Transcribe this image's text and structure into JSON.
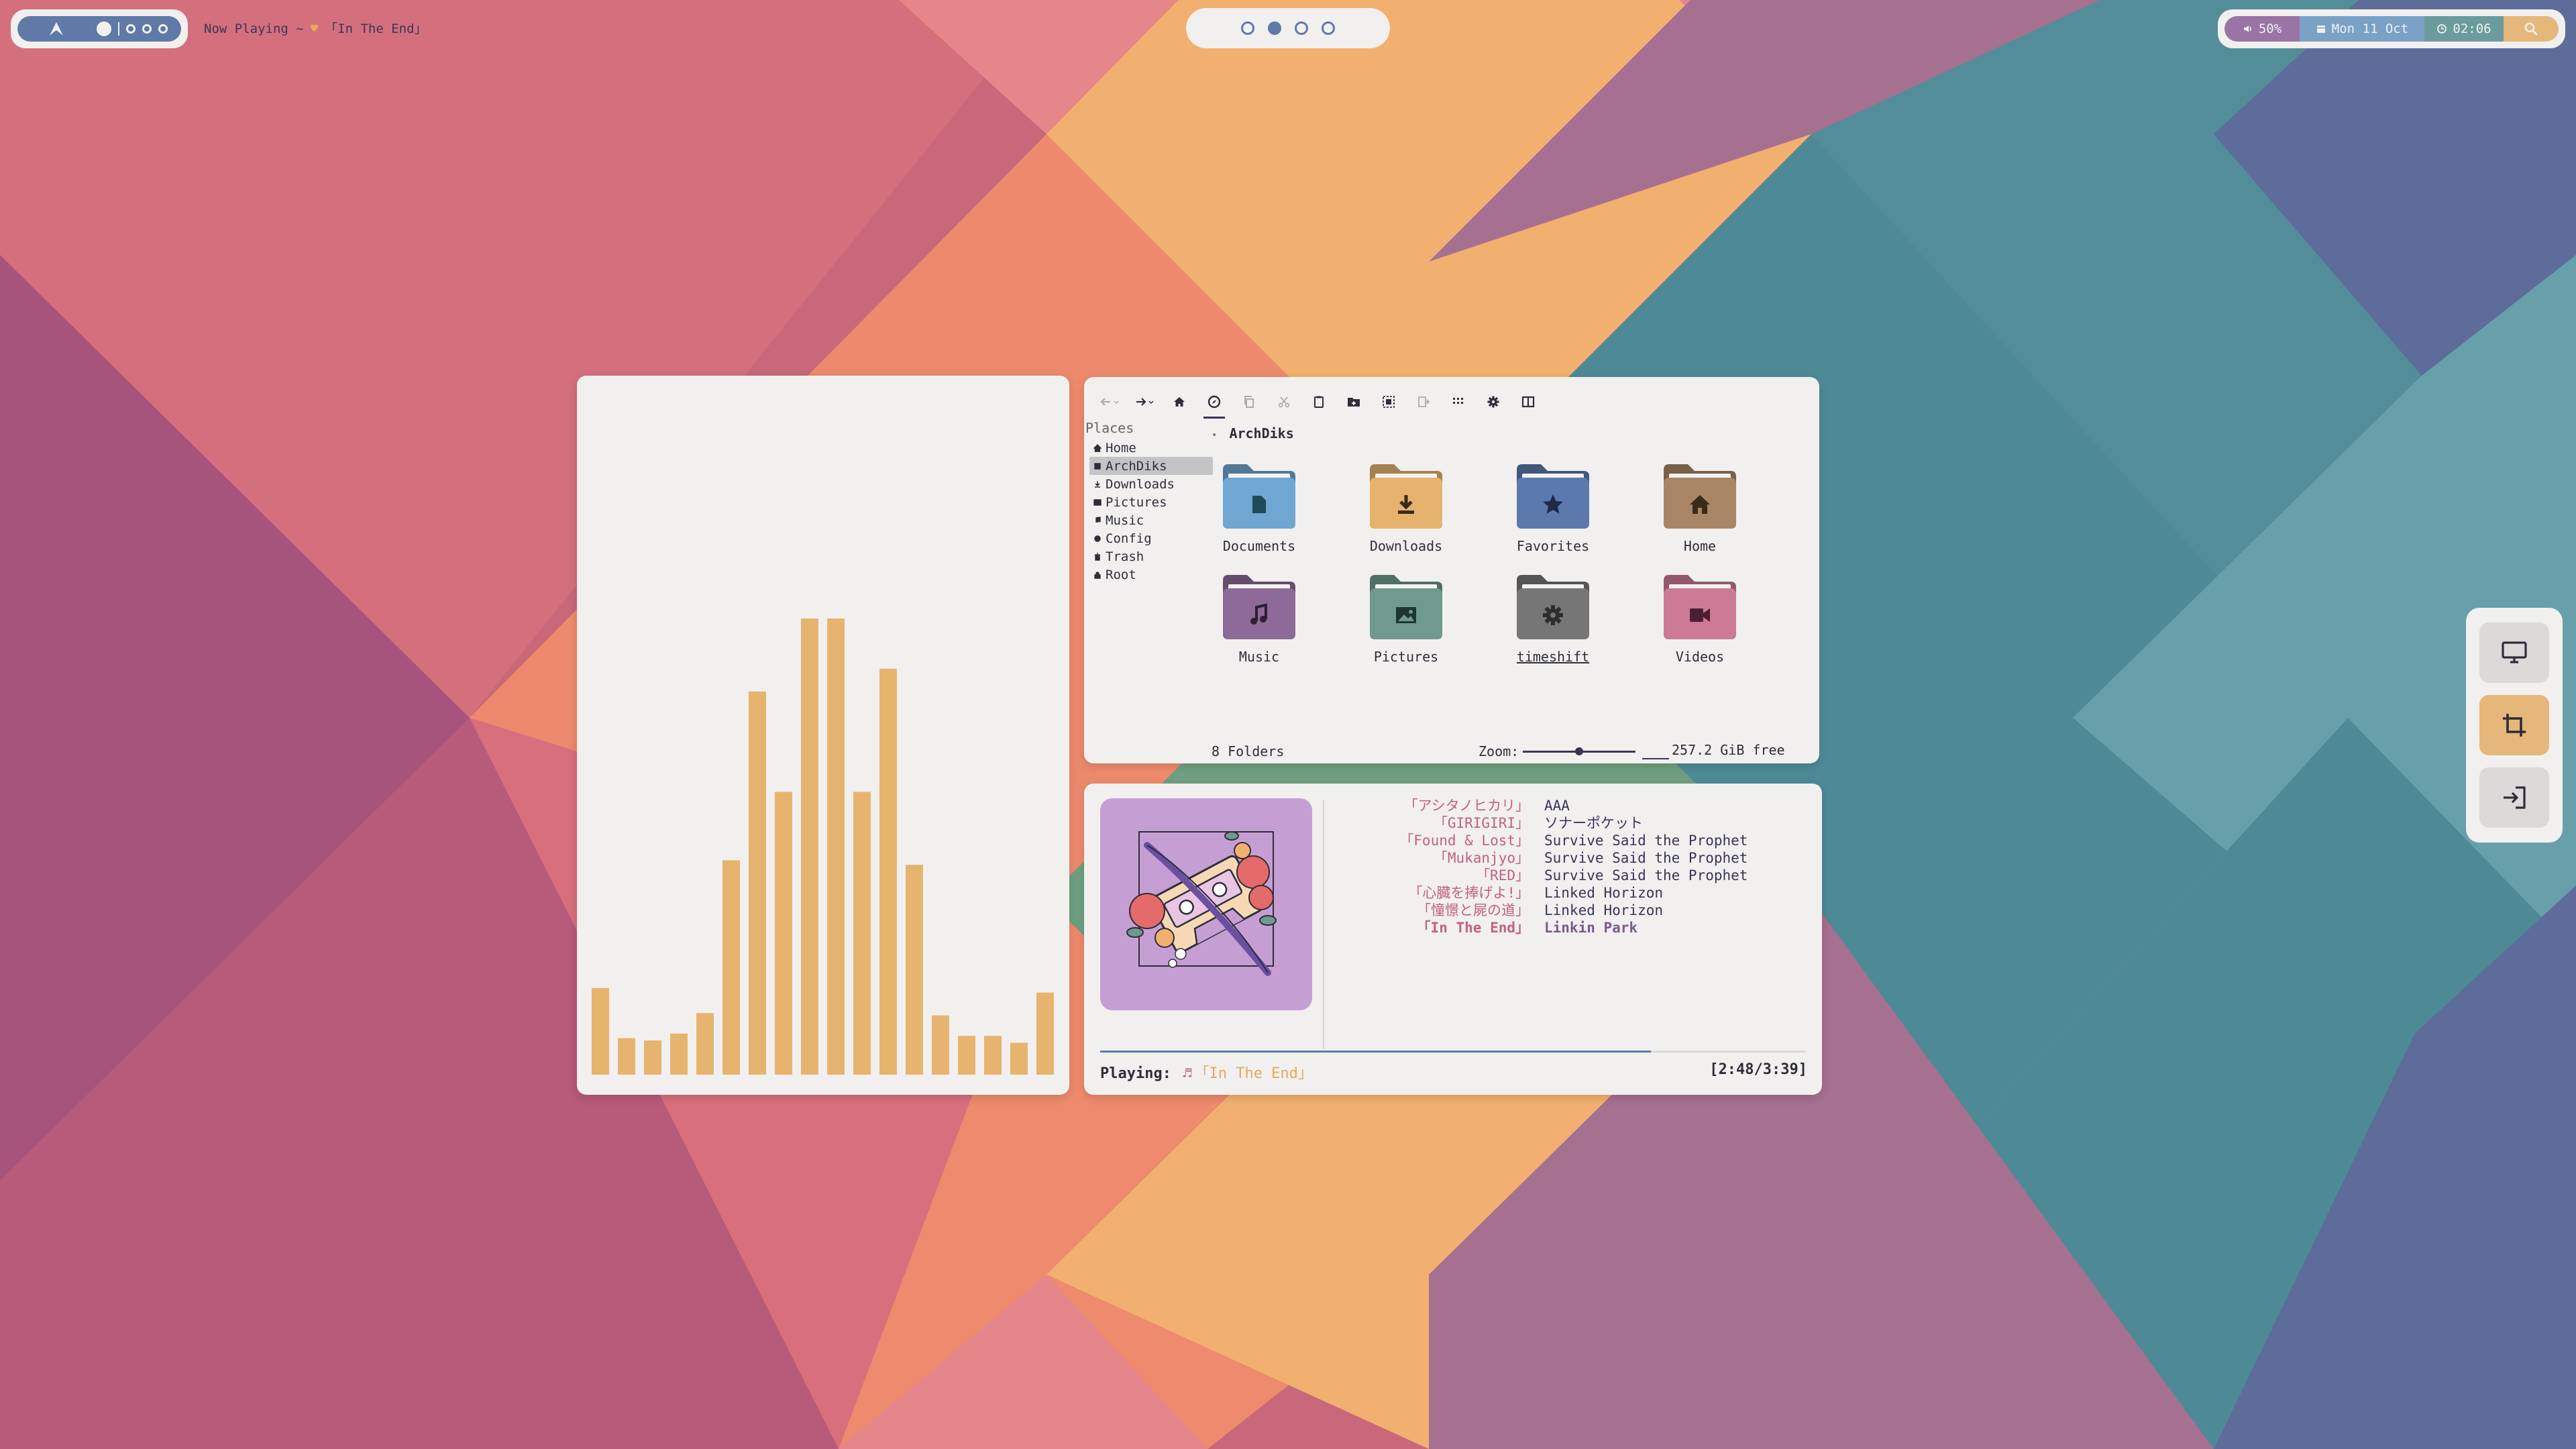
{
  "topbar": {
    "now_playing_label": "Now Playing ~",
    "now_playing_track": "「In The End」",
    "workspaces": [
      {
        "active": false
      },
      {
        "active": true
      },
      {
        "active": false
      },
      {
        "active": false
      }
    ],
    "volume": "50%",
    "date": "Mon 11 Oct",
    "time": "02:06"
  },
  "visualizer": {
    "bar_color": "#e6b46e",
    "levels": [
      0.19,
      0.08,
      0.075,
      0.09,
      0.135,
      0.47,
      0.84,
      0.62,
      1.0,
      1.0,
      0.62,
      0.89,
      0.46,
      0.13,
      0.085,
      0.085,
      0.07,
      0.18
    ]
  },
  "file_manager": {
    "places_title": "Places",
    "places": [
      {
        "label": "Home",
        "icon": "home-icon",
        "selected": false
      },
      {
        "label": "ArchDiks",
        "icon": "drive-icon",
        "selected": true
      },
      {
        "label": "Downloads",
        "icon": "download-icon",
        "selected": false
      },
      {
        "label": "Pictures",
        "icon": "image-icon",
        "selected": false
      },
      {
        "label": "Music",
        "icon": "music-icon",
        "selected": false
      },
      {
        "label": "Config",
        "icon": "gear-icon",
        "selected": false
      },
      {
        "label": "Trash",
        "icon": "trash-icon",
        "selected": false
      },
      {
        "label": "Root",
        "icon": "lock-icon",
        "selected": false
      }
    ],
    "breadcrumb": "ArchDiks",
    "folders": [
      {
        "label": "Documents",
        "color": "#6fa6d2",
        "icon": "document-icon"
      },
      {
        "label": "Downloads",
        "color": "#e6b36e",
        "icon": "download-icon"
      },
      {
        "label": "Favorites",
        "color": "#5b79ad",
        "icon": "star-icon"
      },
      {
        "label": "Home",
        "color": "#a88665",
        "icon": "home-icon"
      },
      {
        "label": "Music",
        "color": "#8e6a98",
        "icon": "music-icon"
      },
      {
        "label": "Pictures",
        "color": "#6f9a8d",
        "icon": "image-icon"
      },
      {
        "label": "timeshift",
        "color": "#767676",
        "icon": "gear-icon"
      },
      {
        "label": "Videos",
        "color": "#cc7a95",
        "icon": "video-icon"
      }
    ],
    "status": "8 Folders",
    "zoom_label": "Zoom:",
    "zoom_level": 0.5,
    "free_space": "257.2 GiB free"
  },
  "music_player": {
    "tracks": [
      {
        "title": "「アシタノヒカリ」",
        "artist": "AAA",
        "current": false
      },
      {
        "title": "「GIRIGIRI」",
        "artist": "ソナーポケット",
        "current": false
      },
      {
        "title": "「Found & Lost」",
        "artist": "Survive Said the Prophet",
        "current": false
      },
      {
        "title": "「Mukanjyo」",
        "artist": "Survive Said the Prophet",
        "current": false
      },
      {
        "title": "「RED」",
        "artist": "Survive Said the Prophet",
        "current": false
      },
      {
        "title": "「心臓を捧げよ!」",
        "artist": "Linked Horizon",
        "current": false
      },
      {
        "title": "「憧憬と屍の道」",
        "artist": "Linked Horizon",
        "current": false
      },
      {
        "title": "「In The End」",
        "artist": "Linkin Park",
        "current": true
      }
    ],
    "progress": 0.78,
    "playing_label": "Playing:",
    "playing_title": "「In The End」",
    "timecode": "[2:48/3:39]"
  }
}
